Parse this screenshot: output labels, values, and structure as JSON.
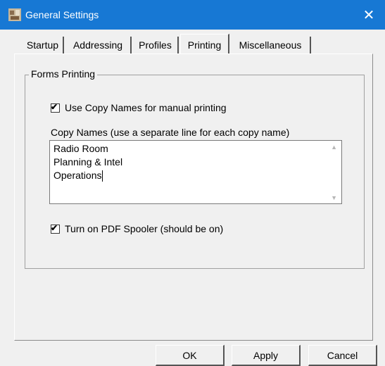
{
  "window": {
    "title": "General Settings",
    "close": "✕"
  },
  "tabs": [
    {
      "label": "Startup"
    },
    {
      "label": "Addressing"
    },
    {
      "label": "Profiles"
    },
    {
      "label": "Printing",
      "active": true
    },
    {
      "label": "Miscellaneous"
    }
  ],
  "forms_printing": {
    "legend": "Forms Printing",
    "use_copy_names": {
      "label": "Use Copy Names for manual printing",
      "checked": true
    },
    "copy_names_label": "Copy Names (use a separate line for each copy name)",
    "copy_names": [
      "Radio Room",
      "Planning & Intel",
      "Operations"
    ],
    "pdf_spooler": {
      "label": "Turn on PDF Spooler (should be on)",
      "checked": true
    }
  },
  "buttons": {
    "ok": "OK",
    "apply": "Apply",
    "cancel": "Cancel"
  },
  "colors": {
    "titlebar": "#1778d4",
    "dialog_bg": "#f0f0f0"
  }
}
